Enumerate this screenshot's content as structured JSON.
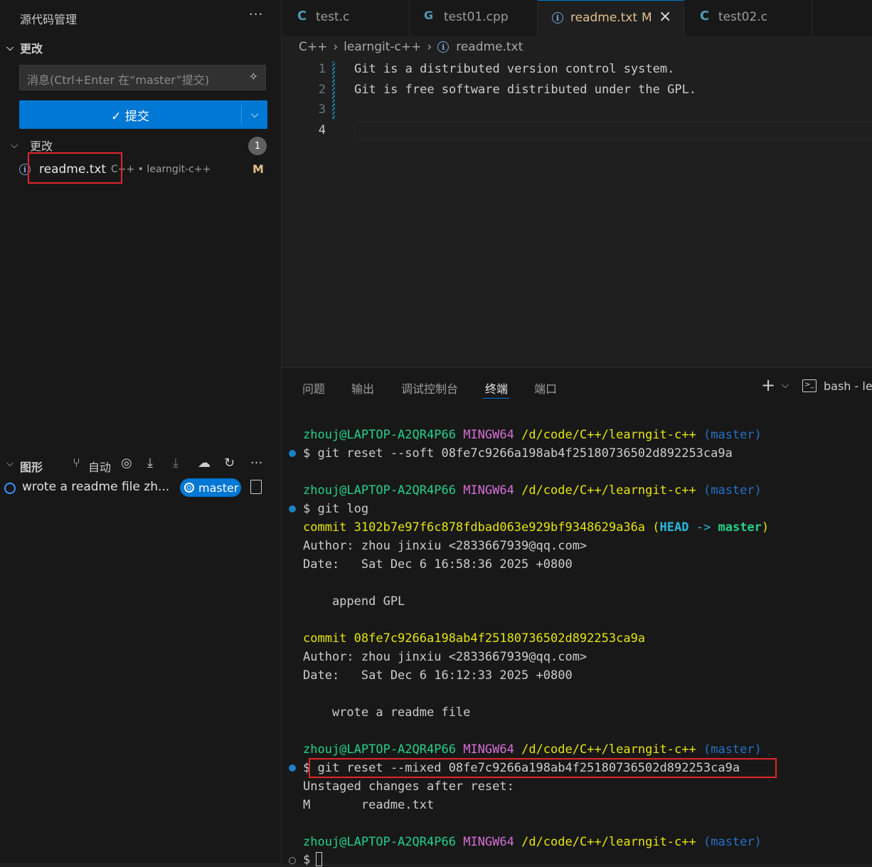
{
  "sidebar": {
    "title": "源代码管理",
    "changes_section": "更改",
    "message_placeholder": "消息(Ctrl+Enter 在“master”提交)",
    "commit_label": "✓ 提交",
    "changes_group": "更改",
    "changes_count": "1",
    "file": {
      "name": "readme.txt",
      "path": "C++ • learngit-c++",
      "status": "M"
    },
    "graph": {
      "title": "图形",
      "auto_label": "自动",
      "commit_message": "wrote a readme file zh...",
      "branch": "master"
    }
  },
  "editor": {
    "tabs": [
      {
        "icon": "C",
        "label": "test.c"
      },
      {
        "icon": "G",
        "label": "test01.cpp"
      },
      {
        "icon": "i",
        "label": "readme.txt",
        "status": "M"
      },
      {
        "icon": "C",
        "label": "test02.c"
      }
    ],
    "breadcrumb": [
      "C++",
      "learngit-c++",
      "readme.txt"
    ],
    "lines": [
      {
        "n": "1",
        "text": "Git is a distributed version control system."
      },
      {
        "n": "2",
        "text": "Git is free software distributed under the GPL."
      },
      {
        "n": "3",
        "text": ""
      },
      {
        "n": "4",
        "text": ""
      }
    ]
  },
  "panel": {
    "tabs": [
      "问题",
      "输出",
      "调试控制台",
      "终端",
      "端口"
    ],
    "active_tab": "终端",
    "terminal_label": "bash - lea"
  },
  "terminal": {
    "prompt": {
      "user": "zhouj@LAPTOP-A2QR4P66",
      "env": "MINGW64",
      "path": "/d/code/C++/learngit-c++",
      "branch": "(master)"
    },
    "cmd1": "$ git reset --soft 08fe7c9266a198ab4f25180736502d892253ca9a",
    "cmd2": "$ git log",
    "commit1_prefix": "commit 3102b7e97f6c878fdbad063e929bf9348629a36a",
    "commit1_open": "(",
    "commit1_head": "HEAD",
    "commit1_arrow": "->",
    "commit1_master": "master",
    "commit1_close": ")",
    "author1": "Author: zhou jinxiu <2833667939@qq.com>",
    "date1": "Date:   Sat Dec 6 16:58:36 2025 +0800",
    "msg1": "    append GPL",
    "commit2": "commit 08fe7c9266a198ab4f25180736502d892253ca9a",
    "author2": "Author: zhou jinxiu <2833667939@qq.com>",
    "date2": "Date:   Sat Dec 6 16:12:33 2025 +0800",
    "msg2": "    wrote a readme file",
    "cmd3": "$ git reset --mixed 08fe7c9266a198ab4f25180736502d892253ca9a",
    "out1": "Unstaged changes after reset:",
    "out2": "M       readme.txt",
    "final_prompt": "$"
  }
}
